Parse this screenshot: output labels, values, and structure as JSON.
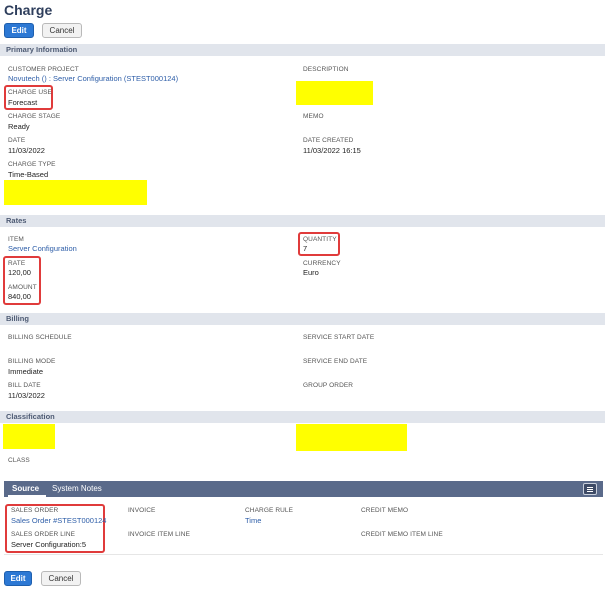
{
  "page": {
    "title": "Charge"
  },
  "toolbar": {
    "edit_label": "Edit",
    "cancel_label": "Cancel"
  },
  "primary": {
    "section_title": "Primary Information",
    "customer_project": {
      "label": "CUSTOMER PROJECT",
      "value": "Novutech () : Server Configuration (STEST000124)"
    },
    "description": {
      "label": "DESCRIPTION"
    },
    "charge_use": {
      "label": "CHARGE USE",
      "value": "Forecast"
    },
    "charge_stage": {
      "label": "CHARGE STAGE",
      "value": "Ready"
    },
    "memo": {
      "label": "MEMO"
    },
    "date": {
      "label": "DATE",
      "value": "11/03/2022"
    },
    "date_created": {
      "label": "DATE CREATED",
      "value": "11/03/2022 16:15"
    },
    "charge_type": {
      "label": "CHARGE TYPE",
      "value": "Time-Based"
    }
  },
  "rates": {
    "section_title": "Rates",
    "item": {
      "label": "ITEM",
      "value": "Server Configuration"
    },
    "quantity": {
      "label": "QUANTITY",
      "value": "7"
    },
    "rate": {
      "label": "RATE",
      "value": "120,00"
    },
    "currency": {
      "label": "CURRENCY",
      "value": "Euro"
    },
    "amount": {
      "label": "AMOUNT",
      "value": "840,00"
    }
  },
  "billing": {
    "section_title": "Billing",
    "billing_schedule": {
      "label": "BILLING SCHEDULE"
    },
    "service_start_date": {
      "label": "SERVICE START DATE"
    },
    "billing_mode": {
      "label": "BILLING MODE",
      "value": "Immediate"
    },
    "service_end_date": {
      "label": "SERVICE END DATE"
    },
    "bill_date": {
      "label": "BILL DATE",
      "value": "11/03/2022"
    },
    "group_order": {
      "label": "GROUP ORDER"
    }
  },
  "classification": {
    "section_title": "Classification",
    "class": {
      "label": "CLASS"
    }
  },
  "subtabs": {
    "source_label": "Source",
    "system_notes_label": "System Notes",
    "sales_order": {
      "label": "SALES ORDER",
      "value": "Sales Order #STEST000124"
    },
    "invoice": {
      "label": "INVOICE"
    },
    "charge_rule": {
      "label": "CHARGE RULE",
      "value": "Time"
    },
    "credit_memo": {
      "label": "CREDIT MEMO"
    },
    "sales_order_line": {
      "label": "SALES ORDER LINE",
      "value": "Server Configuration:5"
    },
    "invoice_item_line": {
      "label": "INVOICE ITEM LINE"
    },
    "credit_memo_item_line": {
      "label": "CREDIT MEMO ITEM LINE"
    }
  },
  "colors": {
    "primary_button": "#2c78d4",
    "section_bar": "#e1e5ec",
    "subtab_bar": "#5a6a8a",
    "link": "#2e5ea8",
    "redaction": "#ffff00",
    "highlight_border": "#e03b3b"
  },
  "icons": {
    "subtab_menu": "menu-icon"
  }
}
